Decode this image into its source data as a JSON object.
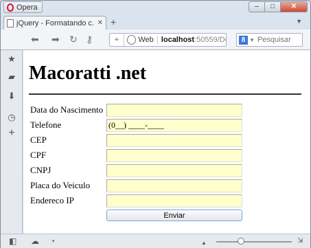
{
  "browser": {
    "menu_label": "Opera",
    "window_controls": {
      "minimize": "‒",
      "maximize": "□",
      "close": "✕"
    }
  },
  "tab": {
    "title": "jQuery - Formatando c...",
    "close": "✕",
    "new_tab": "+"
  },
  "address_bar": {
    "site_label": "Web",
    "url_host": "localhost",
    "url_rest": ":50559/De"
  },
  "search_bar": {
    "engine_letter": "8",
    "placeholder": "Pesquisar"
  },
  "page": {
    "heading": "Macoratti .net",
    "fields": [
      {
        "label": "Data do Nascimento",
        "value": ""
      },
      {
        "label": "Telefone",
        "value": "(0__) ____-____"
      },
      {
        "label": "CEP",
        "value": ""
      },
      {
        "label": "CPF",
        "value": ""
      },
      {
        "label": "CNPJ",
        "value": ""
      },
      {
        "label": "Placa do Veiculo",
        "value": ""
      },
      {
        "label": "Endereco IP",
        "value": ""
      }
    ],
    "submit_label": "Enviar"
  },
  "colors": {
    "input_bg": "#ffffcc",
    "opera_red": "#d4112b",
    "close_button": "#c94a35"
  },
  "icons": {
    "sidebar": [
      "star-icon",
      "notes-icon",
      "download-icon",
      "history-icon",
      "plus-icon"
    ],
    "statusbar": [
      "panel-toggle-icon",
      "cloud-icon",
      "speed-icon"
    ]
  }
}
